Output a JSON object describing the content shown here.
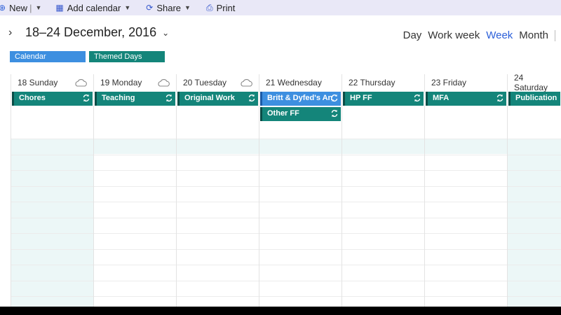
{
  "toolbar": {
    "new_label": "New",
    "add_calendar_label": "Add calendar",
    "share_label": "Share",
    "print_label": "Print"
  },
  "header": {
    "range_title": "18–24 December, 2016",
    "views": [
      "Day",
      "Work week",
      "Week",
      "Month"
    ],
    "active_view": "Week"
  },
  "calendars": [
    {
      "name": "Calendar",
      "color": "#3d8fe0"
    },
    {
      "name": "Themed Days",
      "color": "#14857a"
    }
  ],
  "days": [
    {
      "label": "18 Sunday",
      "weather": "cloud-icon"
    },
    {
      "label": "19 Monday",
      "weather": "cloud-icon"
    },
    {
      "label": "20 Tuesday",
      "weather": "cloud-icon"
    },
    {
      "label": "21 Wednesday"
    },
    {
      "label": "22 Thursday"
    },
    {
      "label": "23 Friday"
    },
    {
      "label": "24 Saturday"
    }
  ],
  "events": [
    {
      "title": "Chores",
      "day": "18 Sunday",
      "calendar": "Themed Days",
      "recurring": true
    },
    {
      "title": "Teaching",
      "day": "19 Monday",
      "calendar": "Themed Days",
      "recurring": true
    },
    {
      "title": "Original Work",
      "day": "20 Tuesday",
      "calendar": "Themed Days",
      "recurring": true
    },
    {
      "title": "Britt & Dyfed's An",
      "day": "21 Wednesday",
      "calendar": "Calendar",
      "recurring": true
    },
    {
      "title": "Other FF",
      "day": "21 Wednesday",
      "calendar": "Themed Days",
      "recurring": true
    },
    {
      "title": "HP FF",
      "day": "22 Thursday",
      "calendar": "Themed Days",
      "recurring": true
    },
    {
      "title": "MFA",
      "day": "23 Friday",
      "calendar": "Themed Days",
      "recurring": true
    },
    {
      "title": "Publication",
      "day": "24 Saturday",
      "calendar": "Themed Days",
      "recurring": false
    }
  ],
  "colors": {
    "toolbar_bg": "#e9e8f7",
    "accent": "#2b5fd9",
    "weekend_shade": "#ecf7f7",
    "themed_event": "#14857a",
    "calendar_event": "#3d8fe0"
  }
}
